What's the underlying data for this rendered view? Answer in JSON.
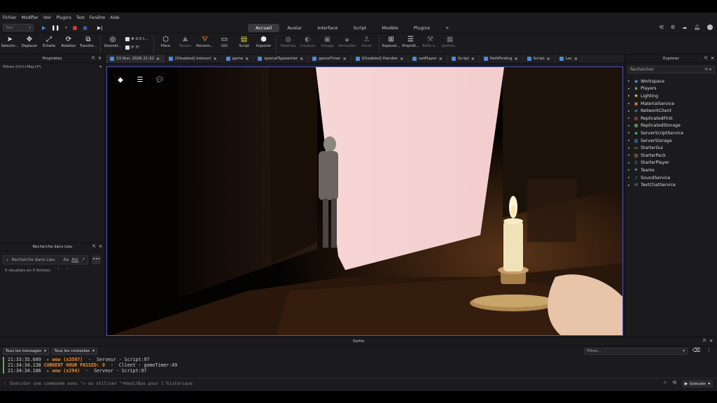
{
  "menu": [
    "Fichier",
    "Modifier",
    "Voir",
    "Plugins",
    "Test",
    "Fenêtre",
    "Aide"
  ],
  "topbar": {
    "test_dropdown": "Test",
    "ribbon_tabs": [
      "Accueil",
      "Avatar",
      "Interface",
      "Script",
      "Modèle",
      "Plugins"
    ],
    "active_tab": "Accueil",
    "add_tab": "+"
  },
  "toolbar": {
    "tools": [
      "Sélectio...",
      "Déplacer",
      "Échelle",
      "Rotation",
      "Transfor...",
      "Géomét..."
    ],
    "move_step": "0.5 t...",
    "rotate_step": "5°",
    "insert": [
      "Pièce",
      "Terrain",
      "Personn...",
      "GUI",
      "Script",
      "Importer"
    ],
    "edit": [
      "Matériau",
      "Couleurs",
      "Groupe",
      "Verrouiller",
      "Ancre"
    ],
    "windows": [
      "Explorat...",
      "Propriét...",
      "Boîte à...",
      "Gestion..."
    ]
  },
  "properties": {
    "title": "Propriétés",
    "filter": "Filtres (Ctrl+Maj+P)"
  },
  "find": {
    "title": "Recherche dans Lieu",
    "placeholder": "Recherche dans Lieu",
    "opts": [
      "Aa",
      "Ab|",
      ".*"
    ],
    "more": "•••",
    "results": "0 résultats en 0 fichiers"
  },
  "doc_tabs": [
    {
      "label": "23 févr. 2026 21:32",
      "active": true
    },
    {
      "label": "[Disabled] Interact"
    },
    {
      "label": "game"
    },
    {
      "label": "specialTypewriter"
    },
    {
      "label": "gameTimer"
    },
    {
      "label": "[Disabled] Handler"
    },
    {
      "label": "setPlayer"
    },
    {
      "label": "Script"
    },
    {
      "label": "PathFinding"
    },
    {
      "label": "Script"
    },
    {
      "label": "Loc"
    }
  ],
  "explorer": {
    "title": "Explorer",
    "search": "Rechercher",
    "items": [
      {
        "label": "Workspace",
        "color": "#4aa3e8",
        "icon": "◉"
      },
      {
        "label": "Players",
        "color": "#6cc06c",
        "icon": "♟"
      },
      {
        "label": "Lighting",
        "color": "#f0c73c",
        "icon": "✹"
      },
      {
        "label": "MaterialService",
        "color": "#e07a4a",
        "icon": "▣"
      },
      {
        "label": "NetworkClient",
        "color": "#5a9be0",
        "icon": "⇄"
      },
      {
        "label": "ReplicatedFirst",
        "color": "#d65a5a",
        "icon": "▤"
      },
      {
        "label": "ReplicatedStorage",
        "color": "#6cc06c",
        "icon": "▦"
      },
      {
        "label": "ServerScriptService",
        "color": "#4ab06c",
        "icon": "◆"
      },
      {
        "label": "ServerStorage",
        "color": "#4a9be0",
        "icon": "▥"
      },
      {
        "label": "StarterGui",
        "color": "#f0c73c",
        "icon": "▭"
      },
      {
        "label": "StarterPack",
        "color": "#c08a4a",
        "icon": "▧"
      },
      {
        "label": "StarterPlayer",
        "color": "#5a9be0",
        "icon": "♙"
      },
      {
        "label": "Teams",
        "color": "#6c8ae0",
        "icon": "⚑"
      },
      {
        "label": "SoundService",
        "color": "#4ab0c8",
        "icon": "♪"
      },
      {
        "label": "TextChatService",
        "color": "#5a9be0",
        "icon": "✉"
      }
    ]
  },
  "output": {
    "title": "Sortie",
    "messages_filter": "Tous les messages",
    "contexts_filter": "Tous les contextes",
    "filter_placeholder": "Filtrer...",
    "lines": [
      {
        "time": "21:33:35.689",
        "msg": "  ▸ wow (x3507)",
        "rest": "  -  Serveur - Script:97",
        "msg_color": "#f08a2a",
        "bar": "#3fbf5a"
      },
      {
        "time": "21:34:34.138",
        "msg": " CURRENT HOUR PASSED: 0",
        "rest": "  -  Client - gameTimer:49",
        "msg_color": "#f08a2a",
        "bar": "#3fbf5a"
      },
      {
        "time": "21:34:34.186",
        "msg": "  ▸ wow (x294)",
        "rest": "  -  Serveur - Script:97",
        "msg_color": "#f08a2a",
        "bar": "#3fbf5a"
      }
    ],
    "command_placeholder": "Exécuter une commande avec \"↵ ou utiliser \"+Haut/Bas pour l'historique",
    "execute": "Exécuter"
  },
  "colors": {
    "viewport_border": "#4a52c8",
    "accent": "#2f7de1"
  }
}
